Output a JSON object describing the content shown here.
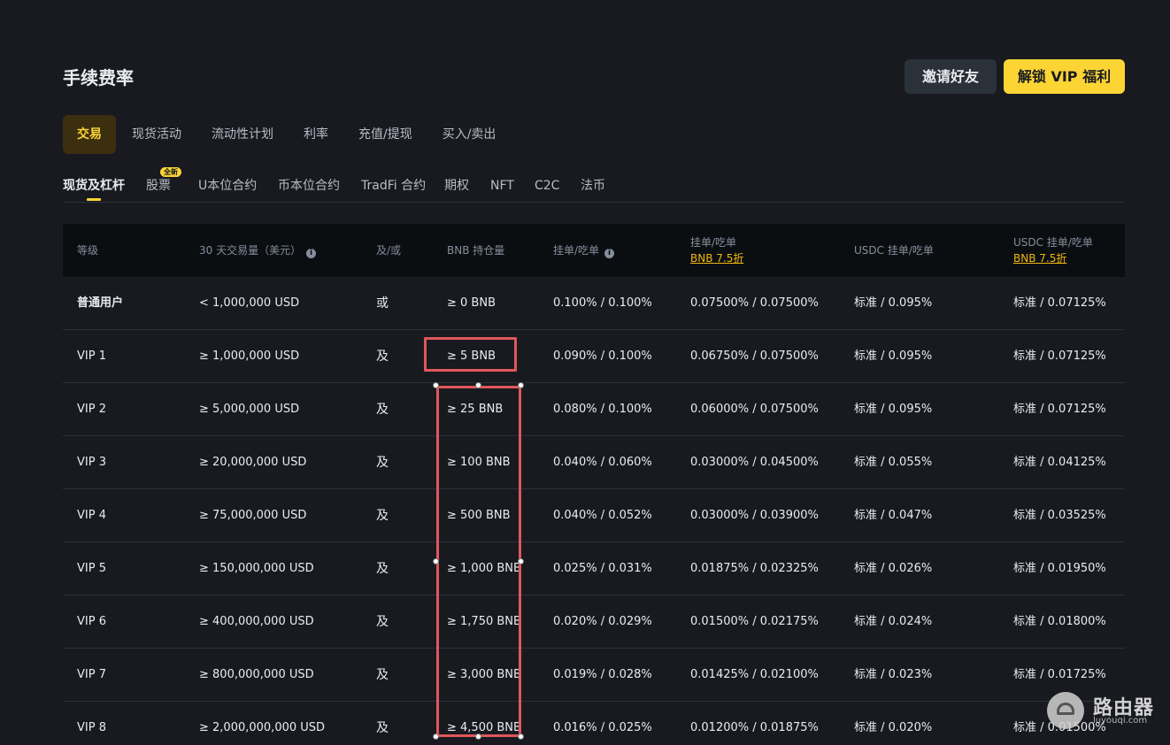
{
  "page": {
    "title": "手续费率",
    "invite_button": "邀请好友",
    "vip_button": "解锁 VIP 福利"
  },
  "tabs_primary": [
    "交易",
    "现货活动",
    "流动性计划",
    "利率",
    "充值/提现",
    "买入/卖出"
  ],
  "tabs_secondary": {
    "items": [
      "现货及杠杆",
      "股票",
      "U本位合约",
      "币本位合约",
      "TradFi 合约",
      "期权",
      "NFT",
      "C2C",
      "法币"
    ],
    "new_badge": "全新"
  },
  "table": {
    "headers": {
      "level": "等级",
      "volume": "30 天交易量（美元）",
      "andor": "及/或",
      "bnb": "BNB 持仓量",
      "maker_taker": "挂单/吃单",
      "maker_taker_bnb": "挂单/吃单",
      "maker_taker_bnb_sub": "BNB 7.5折",
      "usdc": "USDC 挂单/吃单",
      "usdc_bnb": "USDC 挂单/吃单",
      "usdc_bnb_sub": "BNB 7.5折"
    },
    "rows": [
      {
        "level": "普通用户",
        "volume": "< 1,000,000 USD",
        "andor": "或",
        "bnb": "≥ 0 BNB",
        "mt": "0.100% / 0.100%",
        "mt_bnb": "0.07500% / 0.07500%",
        "usdc": "标准 / 0.095%",
        "usdc_bnb": "标准 / 0.07125%"
      },
      {
        "level": "VIP 1",
        "volume": "≥ 1,000,000 USD",
        "andor": "及",
        "bnb": "≥ 5 BNB",
        "mt": "0.090% / 0.100%",
        "mt_bnb": "0.06750% / 0.07500%",
        "usdc": "标准 / 0.095%",
        "usdc_bnb": "标准 / 0.07125%"
      },
      {
        "level": "VIP 2",
        "volume": "≥ 5,000,000 USD",
        "andor": "及",
        "bnb": "≥ 25 BNB",
        "mt": "0.080% / 0.100%",
        "mt_bnb": "0.06000% / 0.07500%",
        "usdc": "标准 / 0.095%",
        "usdc_bnb": "标准 / 0.07125%"
      },
      {
        "level": "VIP 3",
        "volume": "≥ 20,000,000 USD",
        "andor": "及",
        "bnb": "≥ 100 BNB",
        "mt": "0.040% / 0.060%",
        "mt_bnb": "0.03000% / 0.04500%",
        "usdc": "标准 / 0.055%",
        "usdc_bnb": "标准 / 0.04125%"
      },
      {
        "level": "VIP 4",
        "volume": "≥ 75,000,000 USD",
        "andor": "及",
        "bnb": "≥ 500 BNB",
        "mt": "0.040% / 0.052%",
        "mt_bnb": "0.03000% / 0.03900%",
        "usdc": "标准 / 0.047%",
        "usdc_bnb": "标准 / 0.03525%"
      },
      {
        "level": "VIP 5",
        "volume": "≥ 150,000,000 USD",
        "andor": "及",
        "bnb": "≥ 1,000 BNB",
        "mt": "0.025% / 0.031%",
        "mt_bnb": "0.01875% / 0.02325%",
        "usdc": "标准 / 0.026%",
        "usdc_bnb": "标准 / 0.01950%"
      },
      {
        "level": "VIP 6",
        "volume": "≥ 400,000,000 USD",
        "andor": "及",
        "bnb": "≥ 1,750 BNB",
        "mt": "0.020% / 0.029%",
        "mt_bnb": "0.01500% / 0.02175%",
        "usdc": "标准 / 0.024%",
        "usdc_bnb": "标准 / 0.01800%"
      },
      {
        "level": "VIP 7",
        "volume": "≥ 800,000,000 USD",
        "andor": "及",
        "bnb": "≥ 3,000 BNB",
        "mt": "0.019% / 0.028%",
        "mt_bnb": "0.01425% / 0.02100%",
        "usdc": "标准 / 0.023%",
        "usdc_bnb": "标准 / 0.01725%"
      },
      {
        "level": "VIP 8",
        "volume": "≥ 2,000,000,000 USD",
        "andor": "及",
        "bnb": "≥ 4,500 BNB",
        "mt": "0.016% / 0.025%",
        "mt_bnb": "0.01200% / 0.01875%",
        "usdc": "标准 / 0.020%",
        "usdc_bnb": "标准 / 0.01500%"
      }
    ]
  },
  "watermark": {
    "text": "路由器",
    "sub": "luyouqi.com"
  },
  "colors": {
    "background": "#181a20",
    "accent": "#fcd535",
    "highlight": "#e0575b"
  }
}
